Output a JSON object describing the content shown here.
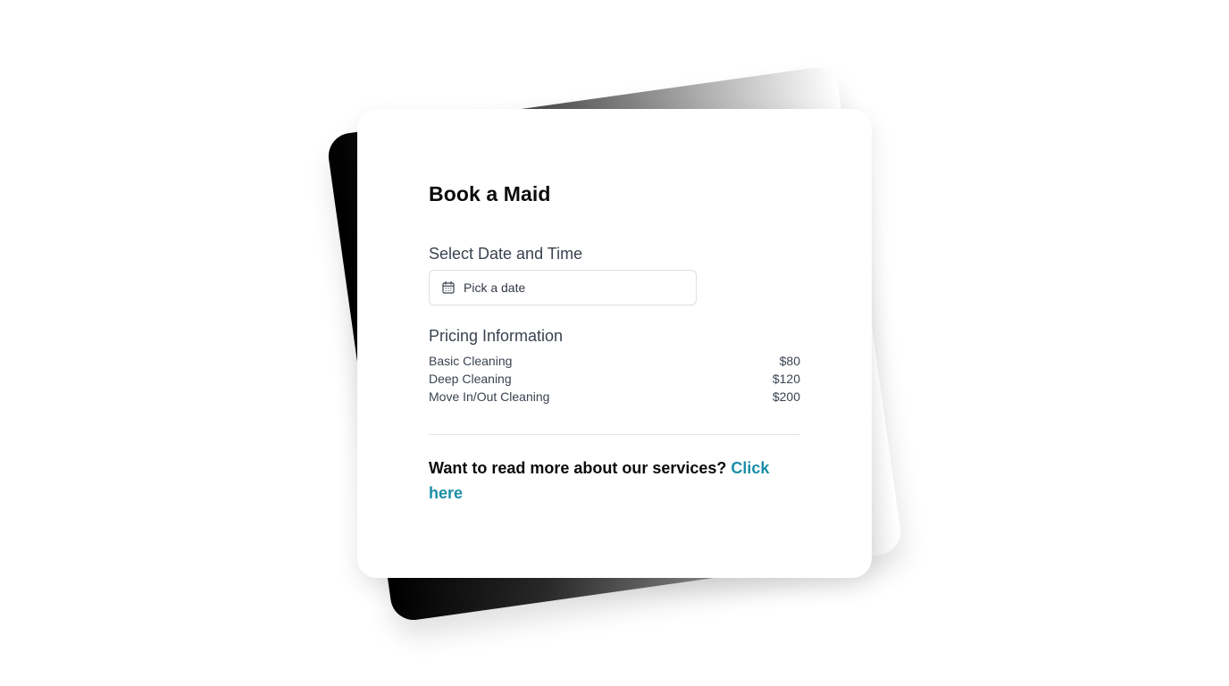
{
  "booking": {
    "title": "Book a Maid",
    "date_section_label": "Select Date and Time",
    "date_input": {
      "placeholder": "Pick a date",
      "icon": "calendar-icon"
    },
    "pricing_label": "Pricing Information",
    "prices": [
      {
        "service": "Basic Cleaning",
        "price": "$80"
      },
      {
        "service": "Deep Cleaning",
        "price": "$120"
      },
      {
        "service": "Move In/Out Cleaning",
        "price": "$200"
      }
    ],
    "cta": {
      "text": "Want to read more about our services?",
      "link_label": "Click here"
    }
  },
  "colors": {
    "link": "#1b8ea6",
    "card_background": "#ffffff",
    "back_card_gradient_start": "#000000",
    "back_card_gradient_end": "#ffffff"
  }
}
